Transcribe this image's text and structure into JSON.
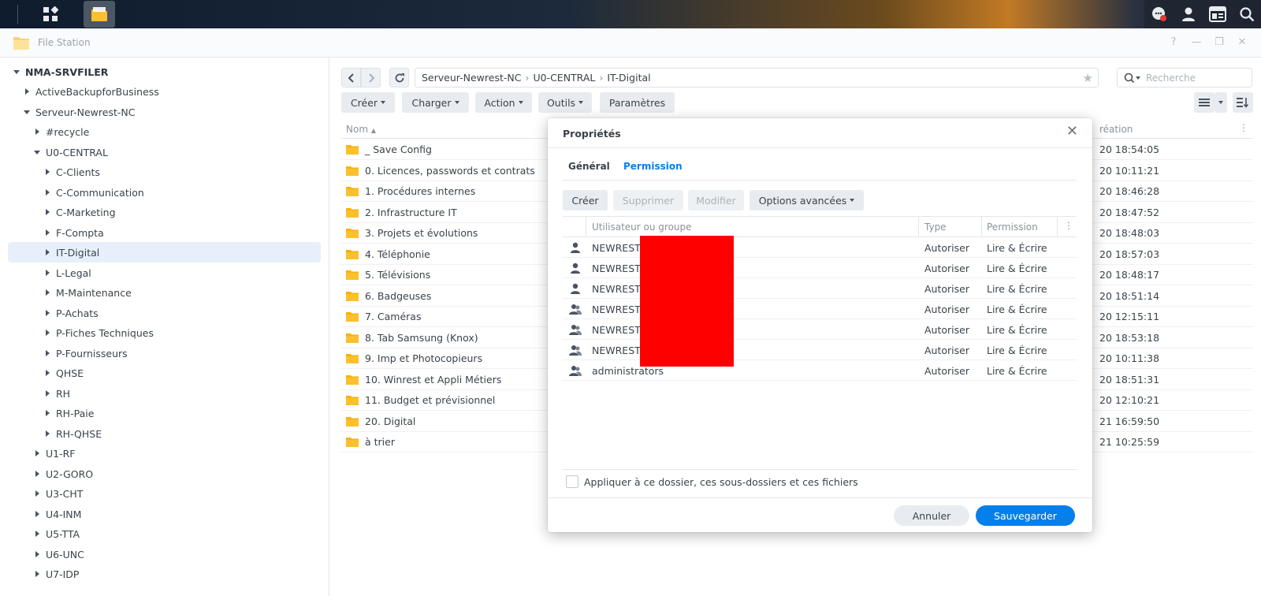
{
  "window": {
    "app_title": "File Station"
  },
  "sidebar": {
    "root": "NMA-SRVFILER",
    "items": [
      "ActiveBackupforBusiness",
      "Serveur-Newrest-NC",
      "#recycle",
      "U0-CENTRAL",
      "C-Clients",
      "C-Communication",
      "C-Marketing",
      "F-Compta",
      "IT-Digital",
      "L-Legal",
      "M-Maintenance",
      "P-Achats",
      "P-Fiches Techniques",
      "P-Fournisseurs",
      "QHSE",
      "RH",
      "RH-Paie",
      "RH-QHSE",
      "U1-RF",
      "U2-GORO",
      "U3-CHT",
      "U4-INM",
      "U5-TTA",
      "U6-UNC",
      "U7-IDP"
    ],
    "selected": "IT-Digital"
  },
  "path": {
    "segments": [
      "Serveur-Newrest-NC",
      "U0-CENTRAL",
      "IT-Digital"
    ]
  },
  "search": {
    "placeholder": "Recherche"
  },
  "toolbar": {
    "create": "Créer",
    "upload": "Charger",
    "action": "Action",
    "tools": "Outils",
    "settings": "Paramètres"
  },
  "list": {
    "col_name": "Nom",
    "col_date": "réation",
    "rows": [
      {
        "name": "_ Save Config",
        "date": "20 18:54:05"
      },
      {
        "name": "0. Licences, passwords et contrats",
        "date": "20 10:11:21"
      },
      {
        "name": "1. Procédures internes",
        "date": "20 18:46:28"
      },
      {
        "name": "2. Infrastructure IT",
        "date": "20 18:47:52"
      },
      {
        "name": "3. Projets et évolutions",
        "date": "20 18:48:03"
      },
      {
        "name": "4. Téléphonie",
        "date": "20 18:57:03"
      },
      {
        "name": "5. Télévisions",
        "date": "20 18:48:17"
      },
      {
        "name": "6. Badgeuses",
        "date": "20 18:51:14"
      },
      {
        "name": "7. Caméras",
        "date": "20 12:15:11"
      },
      {
        "name": "8. Tab Samsung (Knox)",
        "date": "20 18:53:18"
      },
      {
        "name": "9. Imp et Photocopieurs",
        "date": "20 10:11:38"
      },
      {
        "name": "10. Winrest et Appli Métiers",
        "date": "20 18:51:31"
      },
      {
        "name": "11. Budget et prévisionnel",
        "date": "20 12:10:21"
      },
      {
        "name": "20. Digital",
        "date": "21 16:59:50"
      },
      {
        "name": "à trier",
        "date": "21 10:25:59"
      }
    ]
  },
  "dialog": {
    "title": "Propriétés",
    "tabs": [
      "Général",
      "Permission"
    ],
    "active_tab": "Permission",
    "buttons": {
      "create": "Créer",
      "delete": "Supprimer",
      "edit": "Modifier",
      "advanced": "Options avancées"
    },
    "columns": {
      "user": "Utilisateur ou groupe",
      "type": "Type",
      "permission": "Permission"
    },
    "rows": [
      {
        "icon": "user-icon",
        "user": "NEWREST",
        "type": "Autoriser",
        "permission": "Lire & Écrire"
      },
      {
        "icon": "user-icon",
        "user": "NEWREST",
        "type": "Autoriser",
        "permission": "Lire & Écrire"
      },
      {
        "icon": "user-icon",
        "user": "NEWREST",
        "type": "Autoriser",
        "permission": "Lire & Écrire"
      },
      {
        "icon": "group-icon",
        "user": "NEWREST",
        "type": "Autoriser",
        "permission": "Lire & Écrire"
      },
      {
        "icon": "group-icon",
        "user": "NEWREST",
        "type": "Autoriser",
        "permission": "Lire & Écrire"
      },
      {
        "icon": "group-icon",
        "user": "NEWREST",
        "type": "Autoriser",
        "permission": "Lire & Écrire"
      },
      {
        "icon": "group-icon",
        "user": "administrators",
        "type": "Autoriser",
        "permission": "Lire & Écrire"
      }
    ],
    "apply_label": "Appliquer à ce dossier, ces sous-dossiers et ces fichiers",
    "cancel": "Annuler",
    "save": "Sauvegarder"
  },
  "colors": {
    "accent": "#057feb",
    "folder": "#f9b208",
    "redaction": "#ff0000",
    "selected_bg": "#e7f0fa"
  }
}
